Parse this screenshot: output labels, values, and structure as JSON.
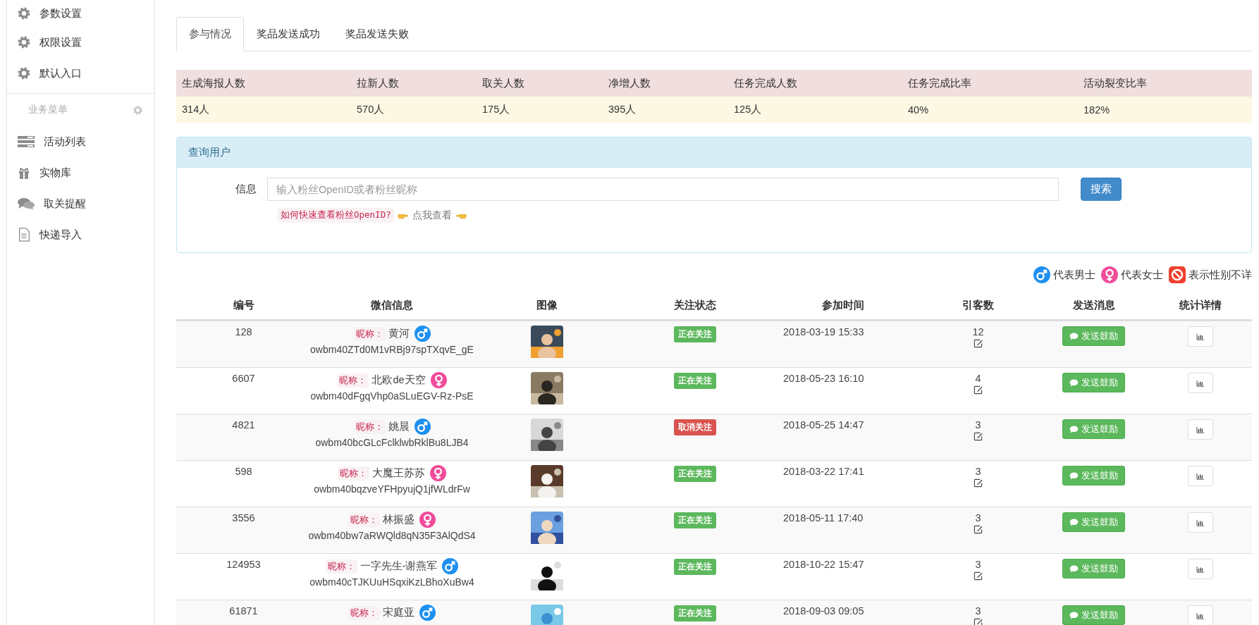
{
  "sidebar": {
    "items": [
      {
        "label": "参数设置"
      },
      {
        "label": "权限设置"
      },
      {
        "label": "默认入口"
      }
    ],
    "section": {
      "label": "业务菜单"
    },
    "menu": [
      {
        "label": "活动列表"
      },
      {
        "label": "实物库"
      },
      {
        "label": "取关提醒"
      },
      {
        "label": "快递导入"
      }
    ]
  },
  "tabs": [
    {
      "label": "参与情况",
      "selected": true
    },
    {
      "label": "奖品发送成功",
      "selected": false
    },
    {
      "label": "奖品发送失败",
      "selected": false
    }
  ],
  "stats": {
    "headers": [
      "生成海报人数",
      "拉新人数",
      "取关人数",
      "净增人数",
      "任务完成人数",
      "任务完成比率",
      "活动裂变比率"
    ],
    "values": [
      "314人",
      "570人",
      "175人",
      "395人",
      "125人",
      "40%",
      "182%"
    ]
  },
  "query": {
    "title": "查询用户",
    "field_label": "信息",
    "placeholder": "输入粉丝OpenID或者粉丝昵称",
    "button": "搜索",
    "hint_code": "如何快速查看粉丝OpenID?",
    "hint_link": "点我查看"
  },
  "legend": [
    {
      "kind": "male",
      "label": "代表男士"
    },
    {
      "kind": "female",
      "label": "代表女士"
    },
    {
      "kind": "unknown",
      "label": "表示性别不详"
    }
  ],
  "table": {
    "columns": [
      "编号",
      "微信信息",
      "图像",
      "关注状态",
      "参加时间",
      "引客数",
      "发送消息",
      "统计详情"
    ],
    "rows": [
      {
        "id": "128",
        "nick_label": "昵称：",
        "nickname": "黄河",
        "kind": "male",
        "openid": "owbm40ZTd0M1vRBj97spTXqvE_gE",
        "following": true,
        "status": "正在关注",
        "time": "2018-03-19 15:33",
        "count": "12",
        "send": "发送鼓励"
      },
      {
        "id": "6607",
        "nick_label": "昵称：",
        "nickname": "北欧de天空",
        "kind": "female",
        "openid": "owbm40dFgqVhp0aSLuEGV-Rz-PsE",
        "following": true,
        "status": "正在关注",
        "time": "2018-05-23 16:10",
        "count": "4",
        "send": "发送鼓励"
      },
      {
        "id": "4821",
        "nick_label": "昵称：",
        "nickname": "姚晨",
        "kind": "male",
        "openid": "owbm40bcGLcFclklwbRklBu8LJB4",
        "following": false,
        "status": "取消关注",
        "time": "2018-05-25 14:47",
        "count": "3",
        "send": "发送鼓励"
      },
      {
        "id": "598",
        "nick_label": "昵称：",
        "nickname": "大魔王苏苏",
        "kind": "female",
        "openid": "owbm40bqzveYFHpyujQ1jfWLdrFw",
        "following": true,
        "status": "正在关注",
        "time": "2018-03-22 17:41",
        "count": "3",
        "send": "发送鼓励"
      },
      {
        "id": "3556",
        "nick_label": "昵称：",
        "nickname": "林振盛",
        "kind": "female",
        "openid": "owbm40bw7aRWQld8qN35F3AlQdS4",
        "following": true,
        "status": "正在关注",
        "time": "2018-05-11 17:40",
        "count": "3",
        "send": "发送鼓励"
      },
      {
        "id": "124953",
        "nick_label": "昵称：",
        "nickname": "一字先生-谢燕军",
        "kind": "male",
        "openid": "owbm40cTJKUuHSqxiKzLBhoXuBw4",
        "following": true,
        "status": "正在关注",
        "time": "2018-10-22 15:47",
        "count": "3",
        "send": "发送鼓励"
      },
      {
        "id": "61871",
        "nick_label": "昵称：",
        "nickname": "宋庭亚",
        "kind": "male",
        "following": true,
        "status": "正在关注",
        "time": "2018-09-03 09:05",
        "count": "3",
        "send": "发送鼓励"
      }
    ]
  }
}
